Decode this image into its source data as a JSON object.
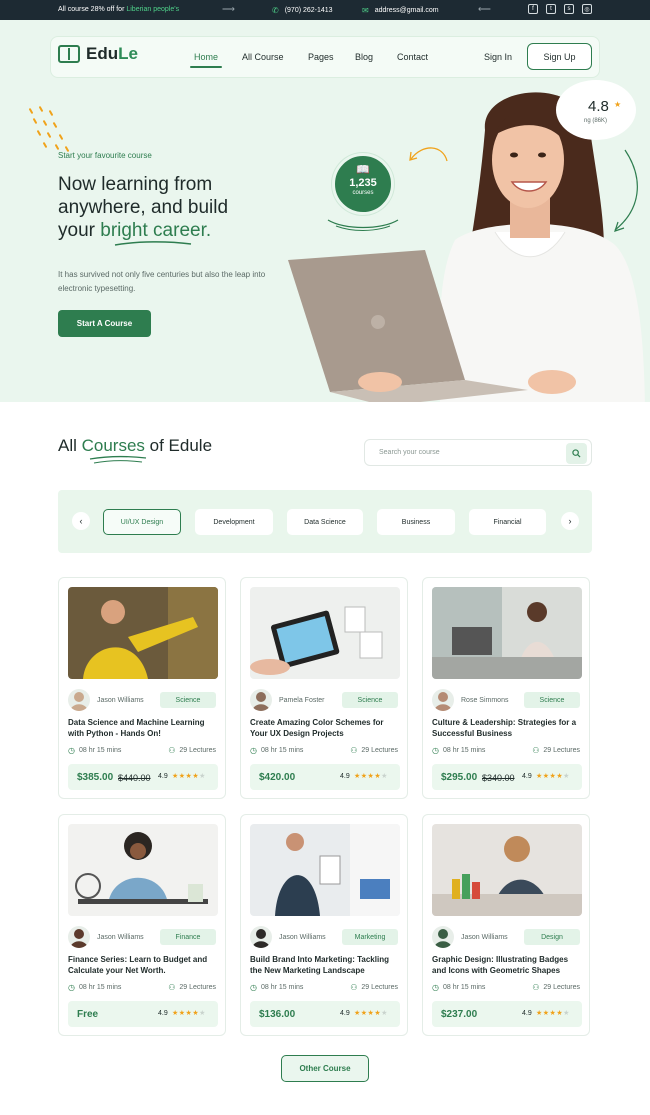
{
  "topbar": {
    "promo_prefix": "All course 28% off for ",
    "promo_highlight": "Liberian people's",
    "phone": "(970) 262-1413",
    "email": "address@gmail.com"
  },
  "brand": {
    "name_a": "Edu",
    "name_b": "Le"
  },
  "nav": {
    "items": [
      {
        "label": "Home"
      },
      {
        "label": "All Course"
      },
      {
        "label": "Pages"
      },
      {
        "label": "Blog"
      },
      {
        "label": "Contact"
      }
    ],
    "sign_in": "Sign In",
    "sign_up": "Sign Up"
  },
  "hero": {
    "kicker": "Start your favourite course",
    "headline_1": "Now learning from",
    "headline_2": "anywhere, and build",
    "headline_3a": "your ",
    "headline_3b": "bright career.",
    "description": "It has survived not only five centuries but also the leap into electronic typesetting.",
    "cta": "Start A Course",
    "courses_count": "1,235",
    "courses_label": "courses",
    "rating_value": "4.8",
    "rating_sub": "ng (86K)"
  },
  "courses_section": {
    "title_a": "All ",
    "title_b": "Courses",
    "title_c": " of Edule",
    "search_placeholder": "Search your course",
    "filters": [
      "UI/UX Design",
      "Development",
      "Data Science",
      "Business",
      "Financial"
    ],
    "active_filter": "UI/UX Design",
    "other_button": "Other Course"
  },
  "courses": [
    {
      "author": "Jason Williams",
      "category": "Science",
      "title": "Data Science and Machine Learning with Python - Hands On!",
      "duration": "08 hr 15 mins",
      "lectures": "29 Lectures",
      "price": "$385.00",
      "old_price": "$440.00",
      "rating": "4.9"
    },
    {
      "author": "Pamela Foster",
      "category": "Science",
      "title": "Create Amazing Color Schemes for Your UX Design Projects",
      "duration": "08 hr 15 mins",
      "lectures": "29 Lectures",
      "price": "$420.00",
      "old_price": "",
      "rating": "4.9"
    },
    {
      "author": "Rose Simmons",
      "category": "Science",
      "title": "Culture & Leadership: Strategies for a Successful Business",
      "duration": "08 hr 15 mins",
      "lectures": "29 Lectures",
      "price": "$295.00",
      "old_price": "$340.00",
      "rating": "4.9"
    },
    {
      "author": "Jason Williams",
      "category": "Finance",
      "title": "Finance Series: Learn to Budget and Calculate your Net Worth.",
      "duration": "08 hr 15 mins",
      "lectures": "29 Lectures",
      "price": "Free",
      "old_price": "",
      "rating": "4.9"
    },
    {
      "author": "Jason Williams",
      "category": "Marketing",
      "title": "Build Brand Into Marketing: Tackling the New Marketing Landscape",
      "duration": "08 hr 15 mins",
      "lectures": "29 Lectures",
      "price": "$136.00",
      "old_price": "",
      "rating": "4.9"
    },
    {
      "author": "Jason Williams",
      "category": "Design",
      "title": "Graphic Design: Illustrating Badges and Icons with Geometric Shapes",
      "duration": "08 hr 15 mins",
      "lectures": "29 Lectures",
      "price": "$237.00",
      "old_price": "",
      "rating": "4.9"
    }
  ],
  "colors": {
    "brand_green": "#2e7d4f",
    "hero_bg": "#eaf6ee",
    "topbar_bg": "#1d2a33",
    "star": "#f0a21a"
  }
}
